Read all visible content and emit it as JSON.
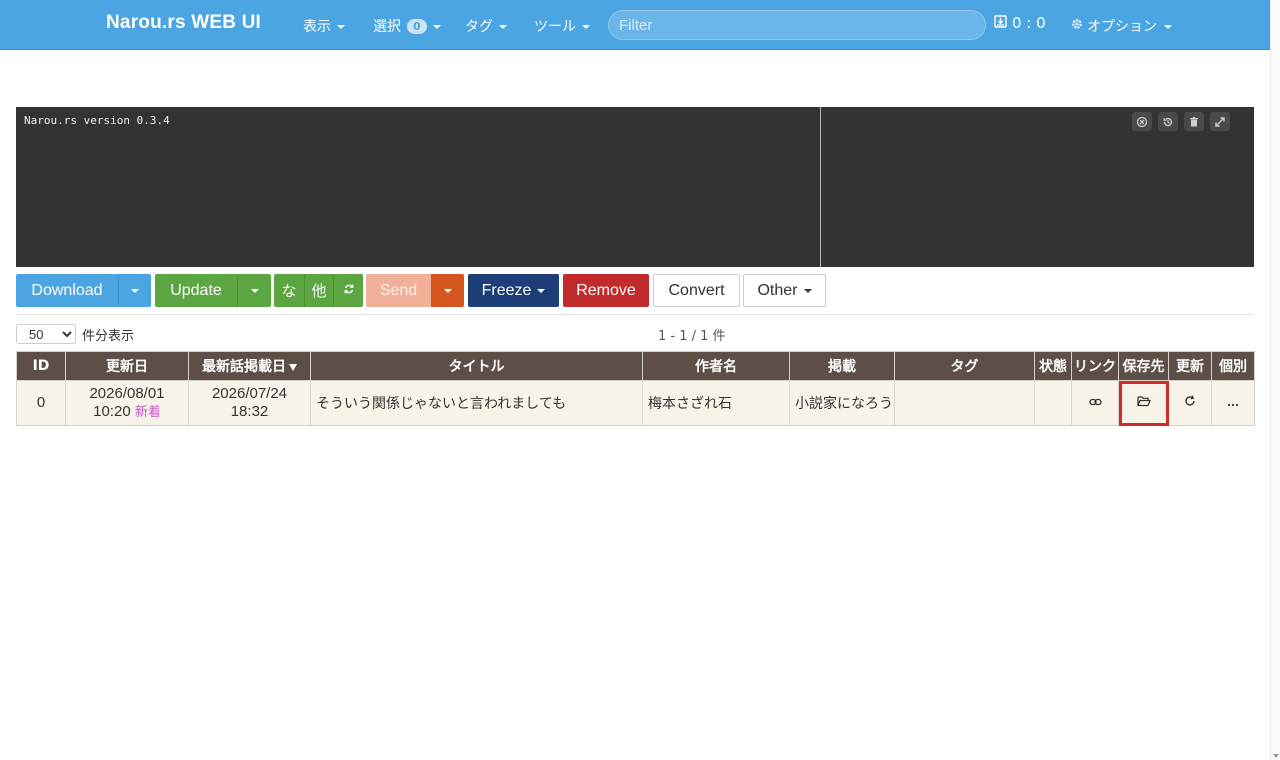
{
  "navbar": {
    "brand": "Narou.rs WEB UI",
    "menu_view": "表示",
    "menu_select": "選択",
    "select_count": "0",
    "menu_tag": "タグ",
    "menu_tools": "ツール",
    "filter_placeholder": "Filter",
    "queue_status": "0 : 0",
    "menu_options": "オプション"
  },
  "console": {
    "text": "Narou.rs version 0.3.4",
    "icons": [
      "close-circle-icon",
      "history-icon",
      "trash-icon",
      "expand-icon"
    ]
  },
  "actions": {
    "download": "Download",
    "update": "Update",
    "na": "な",
    "other_short": "他",
    "send": "Send",
    "freeze": "Freeze",
    "remove": "Remove",
    "convert": "Convert",
    "other": "Other"
  },
  "colors": {
    "navbar": "#4ca5e3",
    "download": "#4ca5e3",
    "update": "#5ca642",
    "send": "#f0b09a",
    "send_split": "#d4561e",
    "freeze": "#1c3d78",
    "remove": "#c22b2b",
    "table_header": "#5d4e48",
    "row_bg": "#f7f3e8"
  },
  "listing": {
    "per_page": "50",
    "per_page_label": "件分表示",
    "page_info": "1 - 1 / 1 件"
  },
  "table": {
    "headers": {
      "id": "ID",
      "updated": "更新日",
      "latest": "最新話掲載日",
      "title": "タイトル",
      "author": "作者名",
      "site": "掲載",
      "tags": "タグ",
      "status": "状態",
      "link": "リンク",
      "save_dir": "保存先",
      "update": "更新",
      "individual": "個別"
    },
    "rows": [
      {
        "id": "0",
        "updated_date": "2026/08/01",
        "updated_time": "10:20",
        "new_badge": "新着",
        "latest_date": "2026/07/24",
        "latest_time": "18:32",
        "title": "そういう関係じゃないと言われましても",
        "author": "梅本さざれ石",
        "site": "小説家になろう",
        "tags": "",
        "status": ""
      }
    ]
  }
}
